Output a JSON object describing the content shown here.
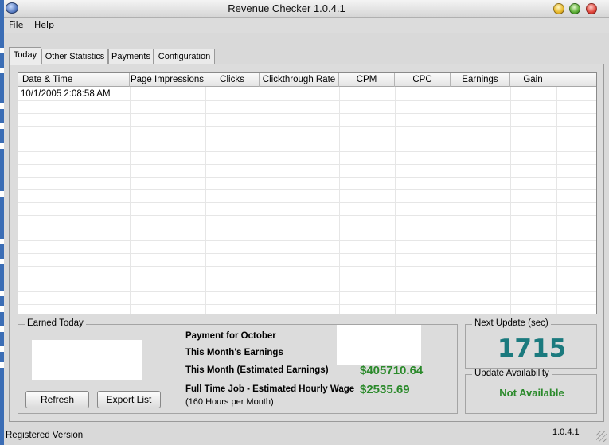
{
  "window": {
    "title": "Revenue Checker 1.0.4.1"
  },
  "menu": [
    "File",
    "Help"
  ],
  "tabs": [
    "Today",
    "Other Statistics",
    "Payments",
    "Configuration"
  ],
  "table": {
    "columns": [
      "Date & Time",
      "Page Impressions",
      "Clicks",
      "Clickthrough Rate",
      "CPM",
      "CPC",
      "Earnings",
      "Gain"
    ],
    "rows": [
      [
        "10/1/2005 2:08:58 AM",
        "",
        "",
        "",
        "",
        "",
        "",
        ""
      ]
    ]
  },
  "earned": {
    "group_label": "Earned Today",
    "refresh_label": "Refresh",
    "export_label": "Export List",
    "payment_label": "Payment for October",
    "month_earnings_label": "This  Month's Earnings",
    "month_estimated_label": "This Month (Estimated Earnings)",
    "month_estimated_value": "$405710.64",
    "hourly_label": "Full Time Job - Estimated Hourly Wage",
    "hourly_value": "$2535.69",
    "hourly_note": "(160 Hours per Month)"
  },
  "next_update": {
    "label": "Next Update  (sec)",
    "value": "1715"
  },
  "availability": {
    "label": "Update Availability",
    "value": "Not Available"
  },
  "status": {
    "registration": "Registered Version",
    "version": "1.0.4.1"
  },
  "colors": {
    "money": "#2b8a2b",
    "countdown": "#1b7a7e"
  }
}
